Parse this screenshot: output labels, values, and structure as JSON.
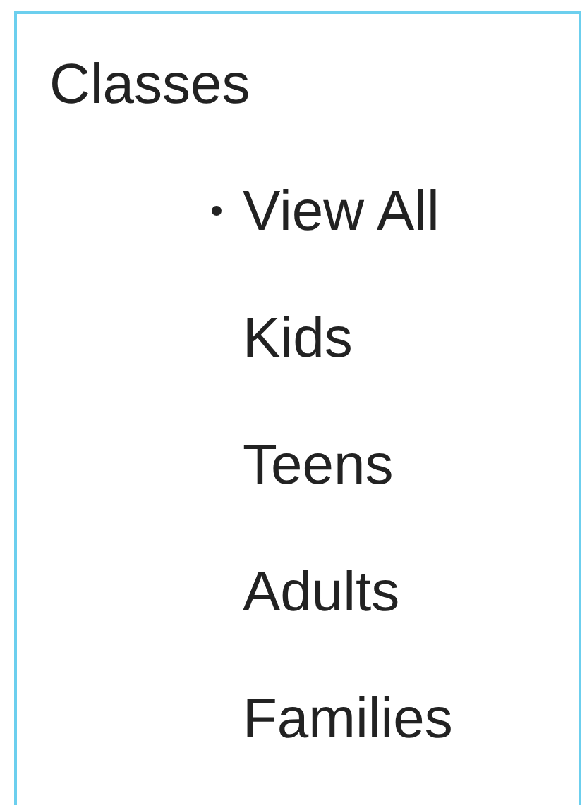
{
  "sidebar": {
    "heading": "Classes",
    "items": [
      {
        "label": "View All",
        "selected": true
      },
      {
        "label": "Kids",
        "selected": false
      },
      {
        "label": "Teens",
        "selected": false
      },
      {
        "label": "Adults",
        "selected": false
      },
      {
        "label": "Families",
        "selected": false
      }
    ]
  }
}
